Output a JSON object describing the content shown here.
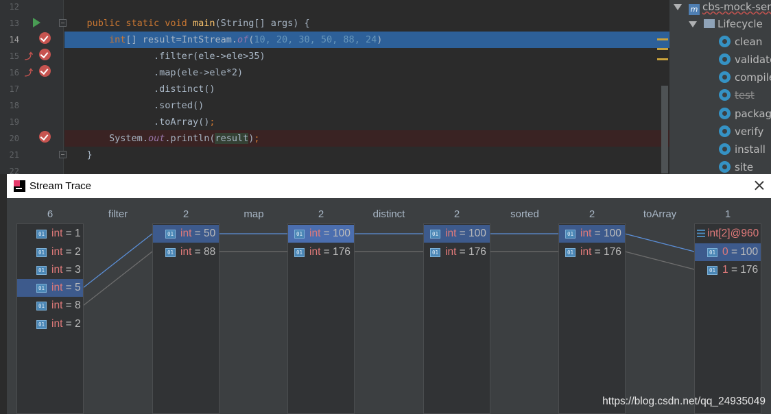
{
  "editor": {
    "line_numbers": [
      "12",
      "13",
      "14",
      "15",
      "16",
      "17",
      "18",
      "19",
      "20",
      "21",
      "22"
    ],
    "code": {
      "l13_kw": "public static void ",
      "l13_fn": "main",
      "l13_rest": "(String[] args) {",
      "l14_kw": "int",
      "l14_a": "[] result=IntStream.",
      "l14_of": "of",
      "l14_b": "(",
      "l14_nums": "10, 20, 30, 50, 88, 24",
      "l14_c": ")",
      "l15": ".filter(ele->ele>35)",
      "l16": ".map(ele->ele*2)",
      "l17": ".distinct()",
      "l18": ".sorted()",
      "l19a": ".toArray()",
      "l19b": ";",
      "l20a": "System.",
      "l20_out": "out",
      "l20b": ".println(",
      "l20_var": "result",
      "l20c": ")",
      "l20d": ";",
      "l21": "}"
    }
  },
  "maven": {
    "project": "cbs-mock-ser",
    "lifecycle": "Lifecycle",
    "goals": [
      "clean",
      "validate",
      "compile",
      "test",
      "package",
      "verify",
      "install",
      "site"
    ]
  },
  "trace": {
    "title": "Stream Trace",
    "counts": [
      "6",
      "2",
      "2",
      "2",
      "2",
      "1"
    ],
    "ops": [
      "filter",
      "map",
      "distinct",
      "sorted",
      "toArray"
    ],
    "columns": [
      [
        "int = 1",
        "int = 2",
        "int = 3",
        "int = 5",
        "int = 8",
        "int = 2"
      ],
      [
        "int = 50",
        "int = 88"
      ],
      [
        "int = 100",
        "int = 176"
      ],
      [
        "int = 100",
        "int = 176"
      ],
      [
        "int = 100",
        "int = 176"
      ]
    ],
    "result": {
      "header": "int[2]@960",
      "items": [
        {
          "index": "0",
          "value": "= 100"
        },
        {
          "index": "1",
          "value": "= 176"
        }
      ]
    },
    "object_icon_text": "01"
  },
  "watermark": "https://blog.csdn.net/qq_24935049",
  "colors": {
    "accent": "#4b6eaf",
    "link_selected": "#5b8fd8",
    "link_normal": "#6e6e6e"
  }
}
